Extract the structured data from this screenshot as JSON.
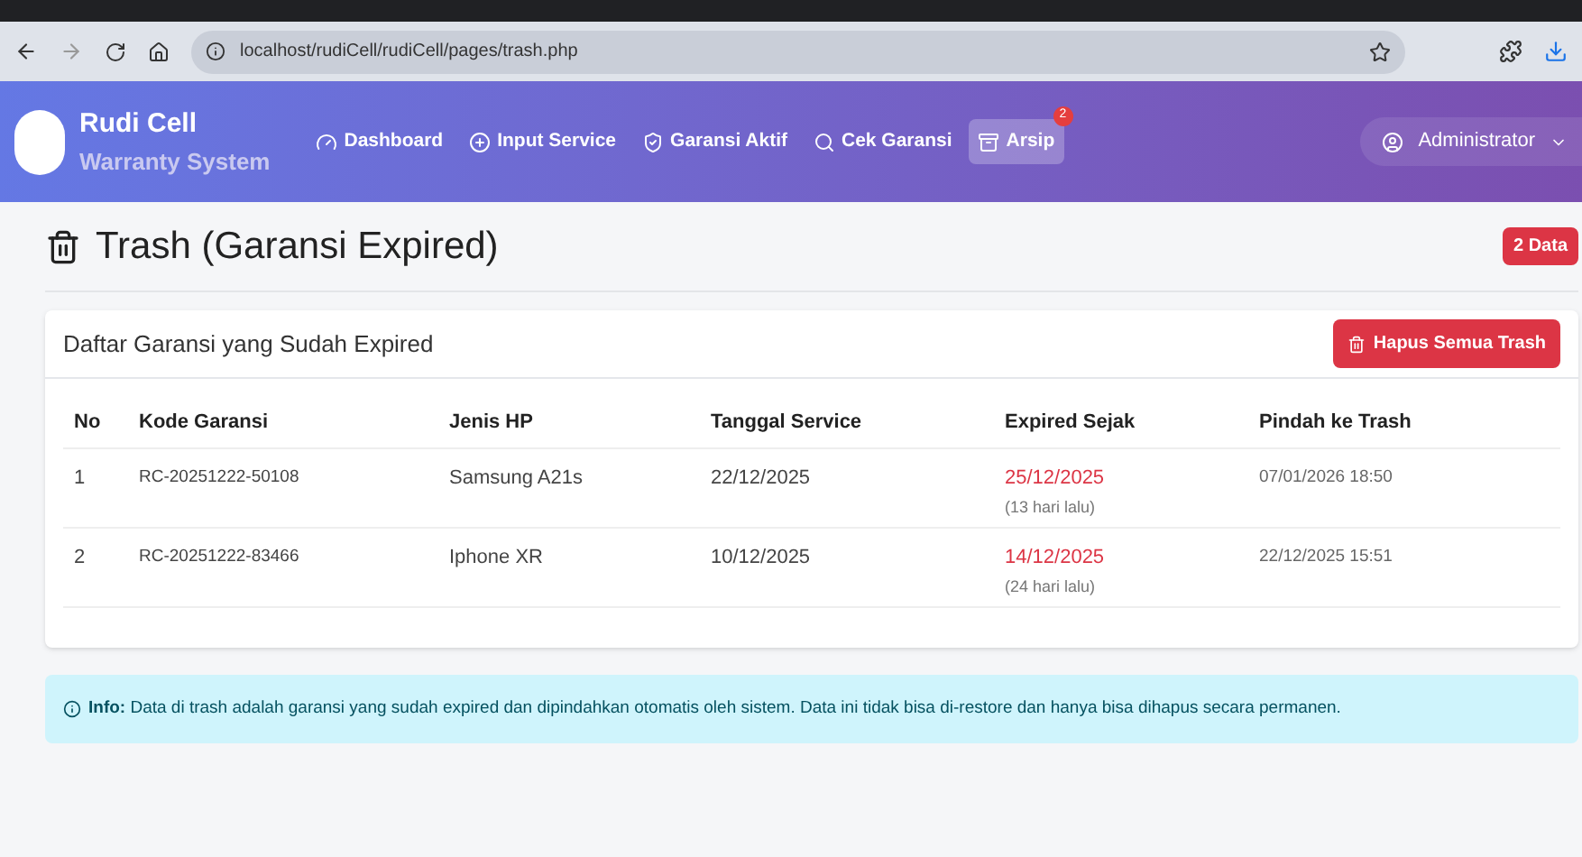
{
  "browser": {
    "url": "localhost/rudiCell/rudiCell/pages/trash.php"
  },
  "navbar": {
    "brand": "Rudi Cell",
    "subtitle": "Warranty System",
    "items": [
      {
        "label": "Dashboard",
        "selected": false
      },
      {
        "label": "Input Service",
        "selected": false
      },
      {
        "label": "Garansi Aktif",
        "selected": false
      },
      {
        "label": "Cek Garansi",
        "selected": false
      },
      {
        "label": "Arsip",
        "selected": true,
        "badge": "2"
      }
    ],
    "user": "Administrator"
  },
  "page": {
    "title": "Trash (Garansi Expired)",
    "count_badge": "2 Data"
  },
  "card": {
    "title": "Daftar Garansi yang Sudah Expired",
    "delete_button": "Hapus Semua Trash",
    "table": {
      "columns": [
        "No",
        "Kode Garansi",
        "Jenis HP",
        "Tanggal Service",
        "Expired Sejak",
        "Pindah ke Trash"
      ],
      "rows": [
        {
          "no": "1",
          "kode": "RC-20251222-50108",
          "jenis": "Samsung A21s",
          "tanggal": "22/12/2025",
          "expired": "25/12/2025",
          "ago": "(13 hari lalu)",
          "moved": "07/01/2026 18:50"
        },
        {
          "no": "2",
          "kode": "RC-20251222-83466",
          "jenis": "Iphone XR",
          "tanggal": "10/12/2025",
          "expired": "14/12/2025",
          "ago": "(24 hari lalu)",
          "moved": "22/12/2025 15:51"
        }
      ]
    }
  },
  "info": {
    "text": "**Info:** Data di trash adalah garansi yang sudah expired dan dipindahkan otomatis oleh sistem. Data ini tidak bisa di-restore dan hanya bisa dihapus secara permanen."
  }
}
